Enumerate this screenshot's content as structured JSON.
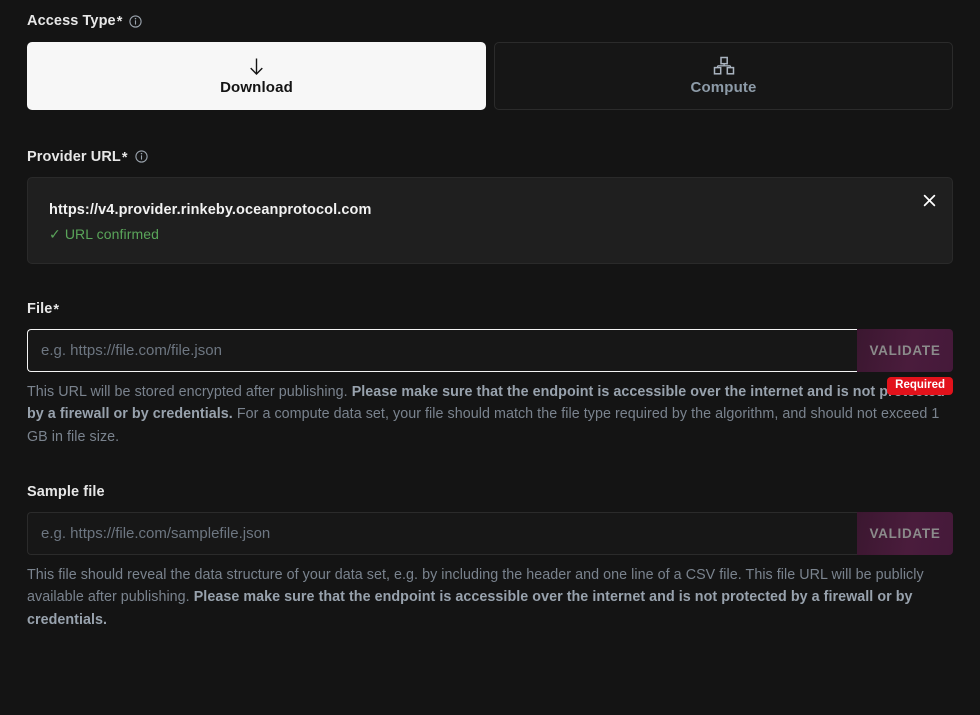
{
  "access_type": {
    "label": "Access Type",
    "required_marker": "*",
    "info_icon": "info-circle-icon",
    "options": [
      {
        "id": "download",
        "label": "Download",
        "icon": "arrow-down-icon",
        "selected": true
      },
      {
        "id": "compute",
        "label": "Compute",
        "icon": "hierarchy-boxes-icon",
        "selected": false
      }
    ]
  },
  "provider_url": {
    "label": "Provider URL",
    "required_marker": "*",
    "info_icon": "info-circle-icon",
    "value": "https://v4.provider.rinkeby.oceanprotocol.com",
    "status_text": "URL confirmed",
    "status_tick": "✓",
    "status_color": "#5aa55a",
    "close_icon": "close-x-icon"
  },
  "file": {
    "label": "File",
    "required_marker": "*",
    "placeholder": "e.g. https://file.com/file.json",
    "value": "",
    "validate_label": "VALIDATE",
    "badge": "Required",
    "badge_color": "#e2121b",
    "help": {
      "part1": "This URL will be stored encrypted after publishing. ",
      "bold1": "Please make sure that the endpoint is accessible over the internet and is not protected by a firewall or by credentials.",
      "part2": " For a compute data set, your file should match the file type required by the algorithm, and should not exceed 1 GB in file size."
    }
  },
  "sample_file": {
    "label": "Sample file",
    "placeholder": "e.g. https://file.com/samplefile.json",
    "value": "",
    "validate_label": "VALIDATE",
    "help": {
      "part1": "This file should reveal the data structure of your data set, e.g. by including the header and one line of a CSV file. This file URL will be publicly available after publishing. ",
      "bold1": "Please make sure that the endpoint is accessible over the internet and is not protected by a firewall or by credentials.",
      "part2": ""
    }
  },
  "theme": {
    "background": "#141414",
    "card_selected_bg": "#f7f7f7",
    "accent_red": "#e2121b",
    "accent_green": "#5aa55a",
    "validate_bg": "#4a1c3c"
  }
}
